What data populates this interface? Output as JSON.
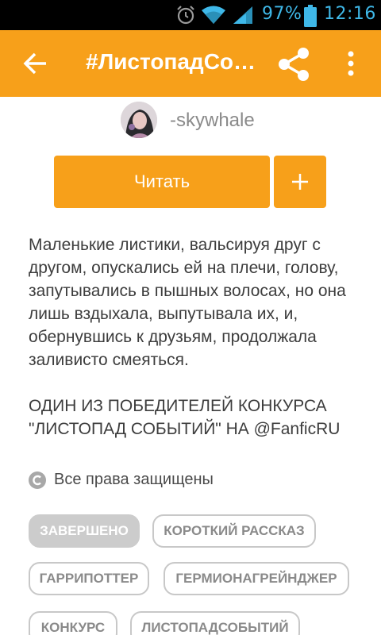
{
  "status_bar": {
    "battery_percent": "97%",
    "time": "12:16",
    "icons": [
      "alarm-icon",
      "wifi-icon",
      "cell-signal-icon",
      "battery-icon"
    ]
  },
  "app_bar": {
    "title": "#ЛистопадСобытий",
    "icons": [
      "back-arrow-icon",
      "share-icon",
      "more-vert-icon"
    ]
  },
  "author": {
    "name": "-skywhale"
  },
  "actions": {
    "read_label": "Читать",
    "add_icon": "plus-icon"
  },
  "description": {
    "paragraph_1": "Маленькие листики, вальсируя друг с другом, опускались ей на плечи, голову, запутывались в пышных волосах, но она лишь вздыхала, выпутывала их, и, обернувшись к друзьям, продолжала заливисто смеяться.",
    "paragraph_2": "ОДИН ИЗ ПОБЕДИТЕЛЕЙ КОНКУРСА \"ЛИСТОПАД СОБЫТИЙ\" НА @FanficRU"
  },
  "rights": {
    "icon": "copyright-icon",
    "text": "Все права защищены"
  },
  "tags": [
    {
      "label": "ЗАВЕРШЕНО",
      "filled": true
    },
    {
      "label": "КОРОТКИЙ РАССКАЗ",
      "filled": false
    },
    {
      "label": "ГАРРИПОТТЕР",
      "filled": false
    },
    {
      "label": "ГЕРМИОНАГРЕЙНДЖЕР",
      "filled": false
    },
    {
      "label": "КОНКУРС",
      "filled": false
    },
    {
      "label": "ЛИСТОПАДСОБЫТИЙ",
      "filled": false
    }
  ],
  "colors": {
    "accent": "#f7a01a",
    "status_text": "#3fb8e8",
    "tag_border": "#c8c8c8"
  }
}
